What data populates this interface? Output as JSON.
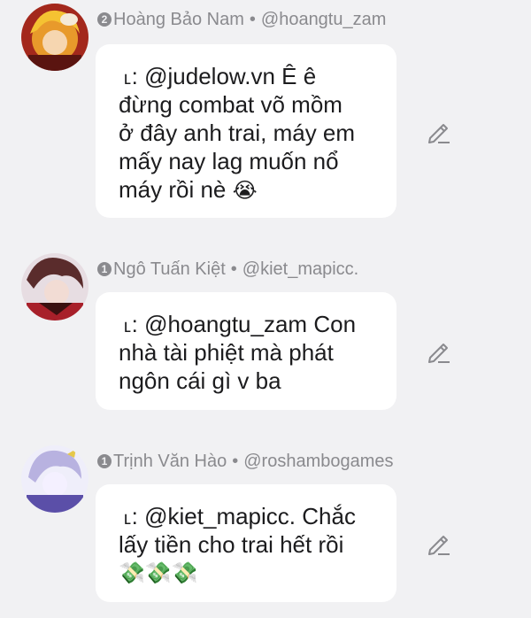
{
  "comments": [
    {
      "rank": "2",
      "name": "Hoàng Bảo Nam",
      "separator": "•",
      "handle": "@hoangtu_zam",
      "reply_mark": "˪:",
      "mention": "@judelow.vn",
      "text_lines": [
        "Ê ê",
        "đừng combat võ mồm",
        "ở đây anh trai, máy em",
        "mấy nay lag muốn nổ",
        "máy rồi nè"
      ],
      "emoji": "😭",
      "avatar_icon": "anime-boy-avatar-orange"
    },
    {
      "rank": "1",
      "name": "Ngô Tuấn Kiệt",
      "separator": "•",
      "handle": "@kiet_mapicc.",
      "reply_mark": "˪:",
      "mention": "@hoangtu_zam",
      "text_lines": [
        "Con",
        "nhà tài phiệt mà phát",
        "ngôn cái gì v ba"
      ],
      "emoji": "",
      "avatar_icon": "anime-boy-avatar-red"
    },
    {
      "rank": "1",
      "name": "Trịnh Văn Hào",
      "separator": "•",
      "handle": "@roshambogames",
      "reply_mark": "˪:",
      "mention": "@kiet_mapicc.",
      "text_lines": [
        "Chắc",
        "lấy tiền cho trai hết rồi"
      ],
      "emoji": "💸💸💸",
      "avatar_icon": "anime-boy-avatar-purple"
    }
  ],
  "icons": {
    "edit": "pencil-icon"
  },
  "colors": {
    "background": "#f1f1f3",
    "bubble": "#ffffff",
    "meta_text": "#8a8a8e",
    "body_text": "#1c1c1e"
  }
}
